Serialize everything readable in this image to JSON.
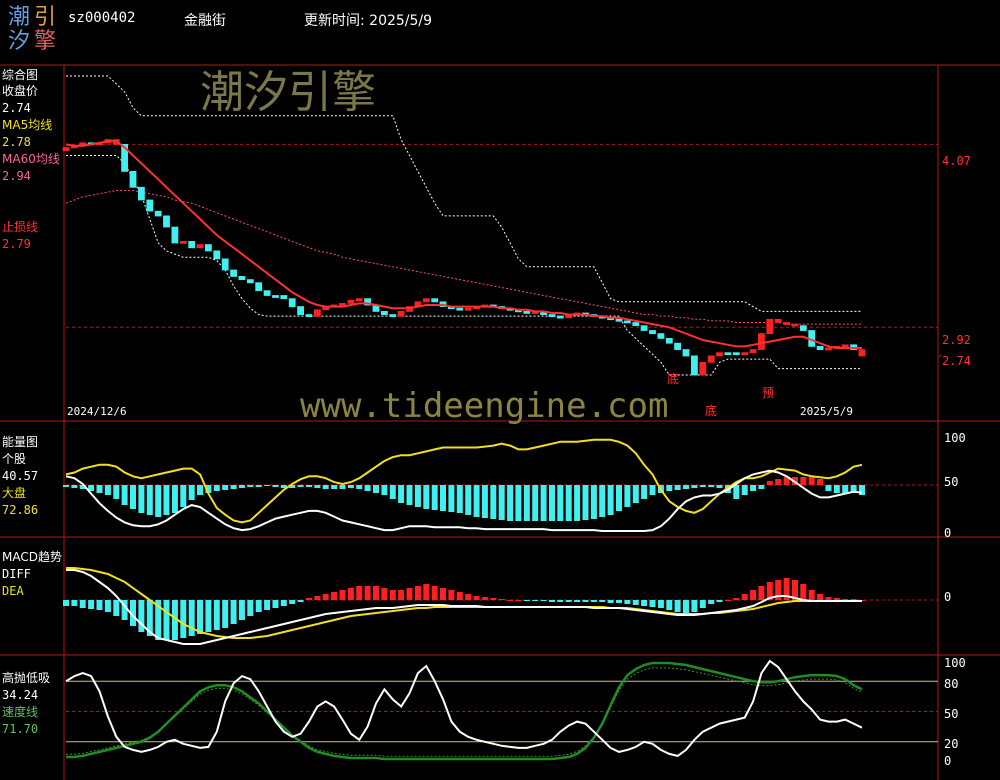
{
  "header": {
    "logo_chars": [
      "潮",
      "引",
      "汐",
      "擎"
    ],
    "code": "sz000402",
    "name": "金融街",
    "update_label": "更新时间: 2025/5/9"
  },
  "watermarks": {
    "cn": "潮汐引擎",
    "url": "www.tideengine.com"
  },
  "colors": {
    "bg": "#000000",
    "frame": "#b01818",
    "up": "#ff2020",
    "down": "#40f0f0",
    "ma5": "#f0e020",
    "ma60": "#ff60a0",
    "stop": "#ff3030",
    "green": "#228b22"
  },
  "panels": {
    "price": {
      "title": "综合图",
      "close_label": "收盘价",
      "close_value": "2.74",
      "ma5_label": "MA5均线",
      "ma5_value": "2.78",
      "ma60_label": "MA60均线",
      "ma60_value": "2.94",
      "stop_label": "止损线",
      "stop_value": "2.79",
      "axis": [
        "4.07",
        "2.92",
        "2.74"
      ],
      "date_start": "2024/12/6",
      "date_end": "2025/5/9",
      "annotations": [
        "底",
        "底",
        "预"
      ]
    },
    "volume": {
      "title": "能量图",
      "stock_label": "个股",
      "stock_value": "40.57",
      "market_label": "大盘",
      "market_value": "72.86",
      "axis": [
        "100",
        "50",
        "0"
      ]
    },
    "macd": {
      "title": "MACD趋势",
      "diff_label": "DIFF",
      "dea_label": "DEA",
      "axis": [
        "0"
      ]
    },
    "hilo": {
      "title": "高抛低吸",
      "value": "34.24",
      "speed_label": "速度线",
      "speed_value": "71.70",
      "axis": [
        "100",
        "80",
        "50",
        "20",
        "0"
      ]
    }
  },
  "chart_data": {
    "type": "bar",
    "title": "金融街",
    "date_range": [
      "2024/12/6",
      "2025/5/9"
    ],
    "price": {
      "close": [
        4.05,
        4.06,
        4.08,
        4.07,
        4.08,
        4.1,
        4.07,
        3.9,
        3.8,
        3.72,
        3.65,
        3.62,
        3.55,
        3.45,
        3.46,
        3.42,
        3.44,
        3.4,
        3.35,
        3.28,
        3.24,
        3.22,
        3.2,
        3.15,
        3.12,
        3.12,
        3.1,
        3.05,
        3.0,
        2.99,
        3.03,
        3.05,
        3.06,
        3.07,
        3.09,
        3.1,
        3.06,
        3.02,
        3.0,
        2.99,
        3.02,
        3.05,
        3.08,
        3.1,
        3.08,
        3.05,
        3.04,
        3.03,
        3.04,
        3.05,
        3.06,
        3.05,
        3.04,
        3.03,
        3.02,
        3.01,
        3.02,
        3.0,
        2.99,
        2.98,
        3.0,
        3.01,
        3.0,
        2.99,
        2.98,
        2.97,
        2.96,
        2.95,
        2.93,
        2.9,
        2.88,
        2.85,
        2.82,
        2.78,
        2.74,
        2.62,
        2.7,
        2.74,
        2.76,
        2.76,
        2.75,
        2.76,
        2.78,
        2.88,
        2.97,
        2.95,
        2.94,
        2.93,
        2.9,
        2.8,
        2.78,
        2.79,
        2.8,
        2.81,
        2.78,
        2.74
      ],
      "up_days": [
        4,
        6,
        49,
        50,
        85,
        86,
        87,
        95
      ],
      "stop_line": [
        4.07,
        4.06,
        4.06,
        4.07,
        4.08,
        4.09,
        4.09,
        4.05,
        4.0,
        3.95,
        3.9,
        3.85,
        3.8,
        3.75,
        3.7,
        3.65,
        3.6,
        3.55,
        3.5,
        3.46,
        3.42,
        3.38,
        3.34,
        3.3,
        3.26,
        3.22,
        3.18,
        3.14,
        3.11,
        3.08,
        3.06,
        3.05,
        3.05,
        3.05,
        3.06,
        3.07,
        3.07,
        3.06,
        3.05,
        3.04,
        3.04,
        3.04,
        3.05,
        3.06,
        3.06,
        3.06,
        3.05,
        3.05,
        3.05,
        3.05,
        3.05,
        3.05,
        3.04,
        3.04,
        3.03,
        3.03,
        3.02,
        3.02,
        3.01,
        3.01,
        3.0,
        3.0,
        3.0,
        2.99,
        2.99,
        2.98,
        2.98,
        2.97,
        2.96,
        2.95,
        2.94,
        2.93,
        2.92,
        2.9,
        2.88,
        2.86,
        2.84,
        2.83,
        2.82,
        2.81,
        2.8,
        2.8,
        2.81,
        2.82,
        2.83,
        2.84,
        2.85,
        2.86,
        2.86,
        2.84,
        2.82,
        2.8,
        2.79,
        2.79,
        2.79,
        2.79
      ],
      "ma60": [
        3.7,
        3.72,
        3.74,
        3.75,
        3.76,
        3.77,
        3.78,
        3.78,
        3.78,
        3.77,
        3.76,
        3.75,
        3.74,
        3.72,
        3.71,
        3.7,
        3.68,
        3.66,
        3.64,
        3.62,
        3.6,
        3.58,
        3.56,
        3.54,
        3.52,
        3.5,
        3.48,
        3.46,
        3.44,
        3.42,
        3.4,
        3.39,
        3.38,
        3.36,
        3.35,
        3.34,
        3.33,
        3.32,
        3.31,
        3.3,
        3.29,
        3.28,
        3.27,
        3.26,
        3.25,
        3.24,
        3.23,
        3.22,
        3.21,
        3.2,
        3.19,
        3.18,
        3.17,
        3.16,
        3.15,
        3.14,
        3.13,
        3.12,
        3.11,
        3.1,
        3.09,
        3.08,
        3.07,
        3.06,
        3.05,
        3.04,
        3.03,
        3.02,
        3.01,
        3.0,
        3.0,
        2.99,
        2.99,
        2.98,
        2.98,
        2.97,
        2.97,
        2.96,
        2.96,
        2.96,
        2.95,
        2.95,
        2.95,
        2.95,
        2.95,
        2.95,
        2.94,
        2.94,
        2.94,
        2.94,
        2.94,
        2.94,
        2.94,
        2.94,
        2.94,
        2.94
      ],
      "upper_band": [
        4.5,
        4.5,
        4.5,
        4.5,
        4.5,
        4.5,
        4.45,
        4.4,
        4.3,
        4.25,
        4.25,
        4.25,
        4.25,
        4.25,
        4.25,
        4.25,
        4.25,
        4.25,
        4.25,
        4.25,
        4.25,
        4.25,
        4.25,
        4.25,
        4.25,
        4.25,
        4.25,
        4.25,
        4.25,
        4.25,
        4.25,
        4.25,
        4.25,
        4.25,
        4.25,
        4.25,
        4.25,
        4.25,
        4.25,
        4.25,
        4.1,
        4.0,
        3.9,
        3.8,
        3.7,
        3.62,
        3.62,
        3.62,
        3.62,
        3.62,
        3.62,
        3.62,
        3.55,
        3.45,
        3.35,
        3.3,
        3.3,
        3.3,
        3.3,
        3.3,
        3.3,
        3.3,
        3.3,
        3.3,
        3.2,
        3.1,
        3.08,
        3.08,
        3.08,
        3.08,
        3.08,
        3.08,
        3.08,
        3.08,
        3.08,
        3.08,
        3.08,
        3.08,
        3.08,
        3.08,
        3.08,
        3.08,
        3.05,
        3.02,
        3.02,
        3.02,
        3.02,
        3.02,
        3.02,
        3.02,
        3.02,
        3.02,
        3.02,
        3.02,
        3.02,
        3.02
      ],
      "lower_band": [
        4.0,
        4.0,
        4.0,
        4.0,
        4.0,
        4.0,
        4.0,
        3.95,
        3.85,
        3.75,
        3.6,
        3.45,
        3.4,
        3.38,
        3.36,
        3.36,
        3.36,
        3.36,
        3.34,
        3.28,
        3.18,
        3.1,
        3.04,
        3.0,
        2.99,
        2.99,
        2.99,
        2.99,
        2.99,
        2.99,
        2.99,
        2.99,
        2.99,
        2.99,
        2.99,
        2.99,
        2.99,
        2.99,
        2.99,
        2.99,
        2.99,
        2.99,
        2.99,
        2.99,
        2.99,
        2.99,
        2.99,
        2.99,
        2.99,
        2.99,
        2.99,
        2.99,
        2.99,
        2.99,
        2.99,
        2.99,
        2.99,
        2.99,
        2.99,
        2.99,
        2.99,
        2.99,
        2.99,
        2.99,
        2.99,
        2.99,
        2.99,
        2.9,
        2.85,
        2.8,
        2.75,
        2.7,
        2.62,
        2.62,
        2.62,
        2.62,
        2.62,
        2.62,
        2.7,
        2.72,
        2.72,
        2.72,
        2.72,
        2.72,
        2.72,
        2.66,
        2.66,
        2.66,
        2.66,
        2.66,
        2.66,
        2.66,
        2.66,
        2.66,
        2.66,
        2.66
      ]
    },
    "volume": {
      "bars": [
        -2,
        -3,
        -4,
        -6,
        -8,
        -10,
        -14,
        -20,
        -24,
        -28,
        -30,
        -32,
        -30,
        -28,
        -22,
        -15,
        -10,
        -8,
        -6,
        -5,
        -4,
        -3,
        -2,
        -2,
        -1,
        -2,
        -3,
        -3,
        -2,
        -2,
        -3,
        -4,
        -4,
        -4,
        -3,
        -4,
        -6,
        -8,
        -10,
        -14,
        -18,
        -20,
        -22,
        -24,
        -25,
        -26,
        -27,
        -28,
        -30,
        -32,
        -33,
        -34,
        -35,
        -36,
        -36,
        -36,
        -36,
        -36,
        -36,
        -36,
        -36,
        -36,
        -35,
        -34,
        -32,
        -30,
        -26,
        -22,
        -18,
        -14,
        -10,
        -8,
        -6,
        -5,
        -4,
        -3,
        -2,
        -2,
        -3,
        -8,
        -14,
        -10,
        -6,
        -4,
        4,
        6,
        8,
        8,
        8,
        8,
        6,
        -6,
        -8,
        -8,
        -8,
        -10
      ],
      "stock": [
        60,
        62,
        66,
        68,
        70,
        70,
        68,
        62,
        58,
        56,
        58,
        60,
        62,
        64,
        66,
        66,
        60,
        40,
        25,
        18,
        12,
        10,
        12,
        20,
        28,
        36,
        44,
        50,
        55,
        58,
        58,
        56,
        52,
        50,
        52,
        56,
        62,
        68,
        74,
        78,
        80,
        80,
        82,
        84,
        86,
        88,
        88,
        88,
        88,
        88,
        89,
        90,
        92,
        90,
        86,
        86,
        88,
        90,
        92,
        94,
        94,
        94,
        95,
        96,
        96,
        96,
        94,
        90,
        82,
        70,
        60,
        44,
        32,
        26,
        22,
        20,
        24,
        32,
        40,
        46,
        52,
        56,
        56,
        58,
        62,
        66,
        65,
        64,
        60,
        58,
        57,
        56,
        58,
        62,
        68,
        70
      ],
      "market": [
        58,
        56,
        50,
        40,
        30,
        22,
        15,
        10,
        7,
        6,
        6,
        8,
        12,
        18,
        24,
        28,
        26,
        20,
        14,
        8,
        4,
        2,
        3,
        6,
        10,
        14,
        16,
        18,
        20,
        22,
        22,
        20,
        16,
        12,
        10,
        8,
        6,
        4,
        2,
        2,
        4,
        6,
        6,
        6,
        5,
        5,
        5,
        5,
        4,
        4,
        3,
        3,
        3,
        3,
        3,
        3,
        3,
        3,
        2,
        2,
        2,
        2,
        2,
        2,
        1,
        1,
        1,
        1,
        1,
        1,
        2,
        6,
        14,
        24,
        32,
        36,
        38,
        38,
        40,
        44,
        50,
        56,
        60,
        62,
        64,
        62,
        58,
        52,
        46,
        40,
        36,
        36,
        38,
        40,
        42,
        41
      ]
    },
    "macd": {
      "bars": [
        -6,
        -6,
        -8,
        -9,
        -10,
        -12,
        -16,
        -20,
        -26,
        -32,
        -36,
        -40,
        -40,
        -40,
        -38,
        -36,
        -34,
        -32,
        -30,
        -28,
        -24,
        -20,
        -16,
        -12,
        -10,
        -8,
        -6,
        -4,
        -2,
        2,
        4,
        6,
        8,
        10,
        12,
        14,
        14,
        14,
        12,
        10,
        10,
        12,
        14,
        16,
        14,
        12,
        10,
        8,
        6,
        4,
        3,
        2,
        1,
        0,
        0,
        -1,
        -1,
        -1,
        -2,
        -2,
        -2,
        -2,
        -2,
        -2,
        -2,
        -3,
        -3,
        -4,
        -5,
        -6,
        -7,
        -8,
        -10,
        -12,
        -14,
        -12,
        -8,
        -4,
        -2,
        0,
        2,
        6,
        10,
        14,
        18,
        20,
        22,
        20,
        16,
        10,
        6,
        3,
        2,
        1,
        1,
        0
      ],
      "diff": [
        30,
        30,
        28,
        24,
        18,
        12,
        4,
        -6,
        -16,
        -24,
        -32,
        -38,
        -40,
        -42,
        -44,
        -44,
        -44,
        -42,
        -40,
        -38,
        -36,
        -34,
        -32,
        -30,
        -28,
        -26,
        -24,
        -22,
        -20,
        -18,
        -16,
        -14,
        -13,
        -12,
        -11,
        -10,
        -9,
        -8,
        -8,
        -8,
        -7,
        -6,
        -5,
        -5,
        -5,
        -5,
        -6,
        -6,
        -6,
        -6,
        -7,
        -7,
        -7,
        -7,
        -7,
        -7,
        -7,
        -7,
        -7,
        -7,
        -7,
        -7,
        -7,
        -8,
        -8,
        -8,
        -8,
        -9,
        -10,
        -11,
        -12,
        -13,
        -14,
        -15,
        -15,
        -15,
        -14,
        -13,
        -12,
        -11,
        -10,
        -8,
        -6,
        -2,
        2,
        4,
        4,
        2,
        0,
        -1,
        -1,
        -1,
        -1,
        -1,
        -1,
        -1
      ],
      "dea": [
        32,
        32,
        31,
        30,
        28,
        26,
        22,
        18,
        12,
        6,
        0,
        -6,
        -12,
        -18,
        -24,
        -28,
        -32,
        -34,
        -36,
        -37,
        -38,
        -38,
        -38,
        -37,
        -36,
        -34,
        -32,
        -30,
        -28,
        -26,
        -24,
        -22,
        -20,
        -18,
        -16,
        -15,
        -14,
        -13,
        -12,
        -11,
        -10,
        -9,
        -8,
        -8,
        -7,
        -7,
        -7,
        -7,
        -7,
        -7,
        -7,
        -7,
        -7,
        -7,
        -7,
        -7,
        -7,
        -7,
        -7,
        -7,
        -7,
        -7,
        -7,
        -7,
        -7,
        -8,
        -8,
        -8,
        -9,
        -10,
        -11,
        -12,
        -13,
        -14,
        -14,
        -14,
        -14,
        -13,
        -13,
        -12,
        -11,
        -10,
        -9,
        -7,
        -5,
        -3,
        -2,
        -1,
        -1,
        -1,
        -1,
        -1,
        -1,
        -1,
        -1,
        -1
      ]
    },
    "hilo": {
      "value": [
        80,
        85,
        88,
        85,
        70,
        45,
        25,
        15,
        12,
        10,
        12,
        15,
        20,
        22,
        18,
        16,
        14,
        15,
        30,
        60,
        78,
        85,
        82,
        70,
        55,
        40,
        30,
        25,
        28,
        40,
        55,
        60,
        55,
        42,
        28,
        22,
        35,
        58,
        72,
        62,
        55,
        68,
        88,
        95,
        80,
        62,
        40,
        30,
        25,
        22,
        20,
        18,
        16,
        15,
        14,
        14,
        16,
        18,
        22,
        30,
        36,
        40,
        38,
        30,
        22,
        14,
        10,
        12,
        15,
        20,
        18,
        12,
        8,
        6,
        12,
        22,
        30,
        34,
        38,
        40,
        42,
        44,
        60,
        88,
        100,
        94,
        82,
        70,
        60,
        52,
        42,
        40,
        40,
        42,
        38,
        34
      ],
      "speed": [
        5,
        5,
        6,
        8,
        10,
        12,
        14,
        16,
        18,
        20,
        24,
        30,
        38,
        46,
        54,
        62,
        70,
        74,
        76,
        76,
        74,
        70,
        64,
        58,
        50,
        42,
        34,
        26,
        20,
        14,
        10,
        8,
        6,
        5,
        4,
        4,
        4,
        4,
        3,
        3,
        3,
        3,
        3,
        3,
        3,
        3,
        3,
        3,
        3,
        3,
        3,
        3,
        3,
        3,
        3,
        3,
        3,
        3,
        3,
        4,
        5,
        8,
        14,
        24,
        38,
        56,
        74,
        86,
        92,
        96,
        98,
        98,
        98,
        97,
        96,
        94,
        92,
        90,
        88,
        86,
        84,
        82,
        80,
        79,
        79,
        80,
        82,
        84,
        85,
        86,
        86,
        86,
        85,
        82,
        76,
        72
      ]
    }
  }
}
